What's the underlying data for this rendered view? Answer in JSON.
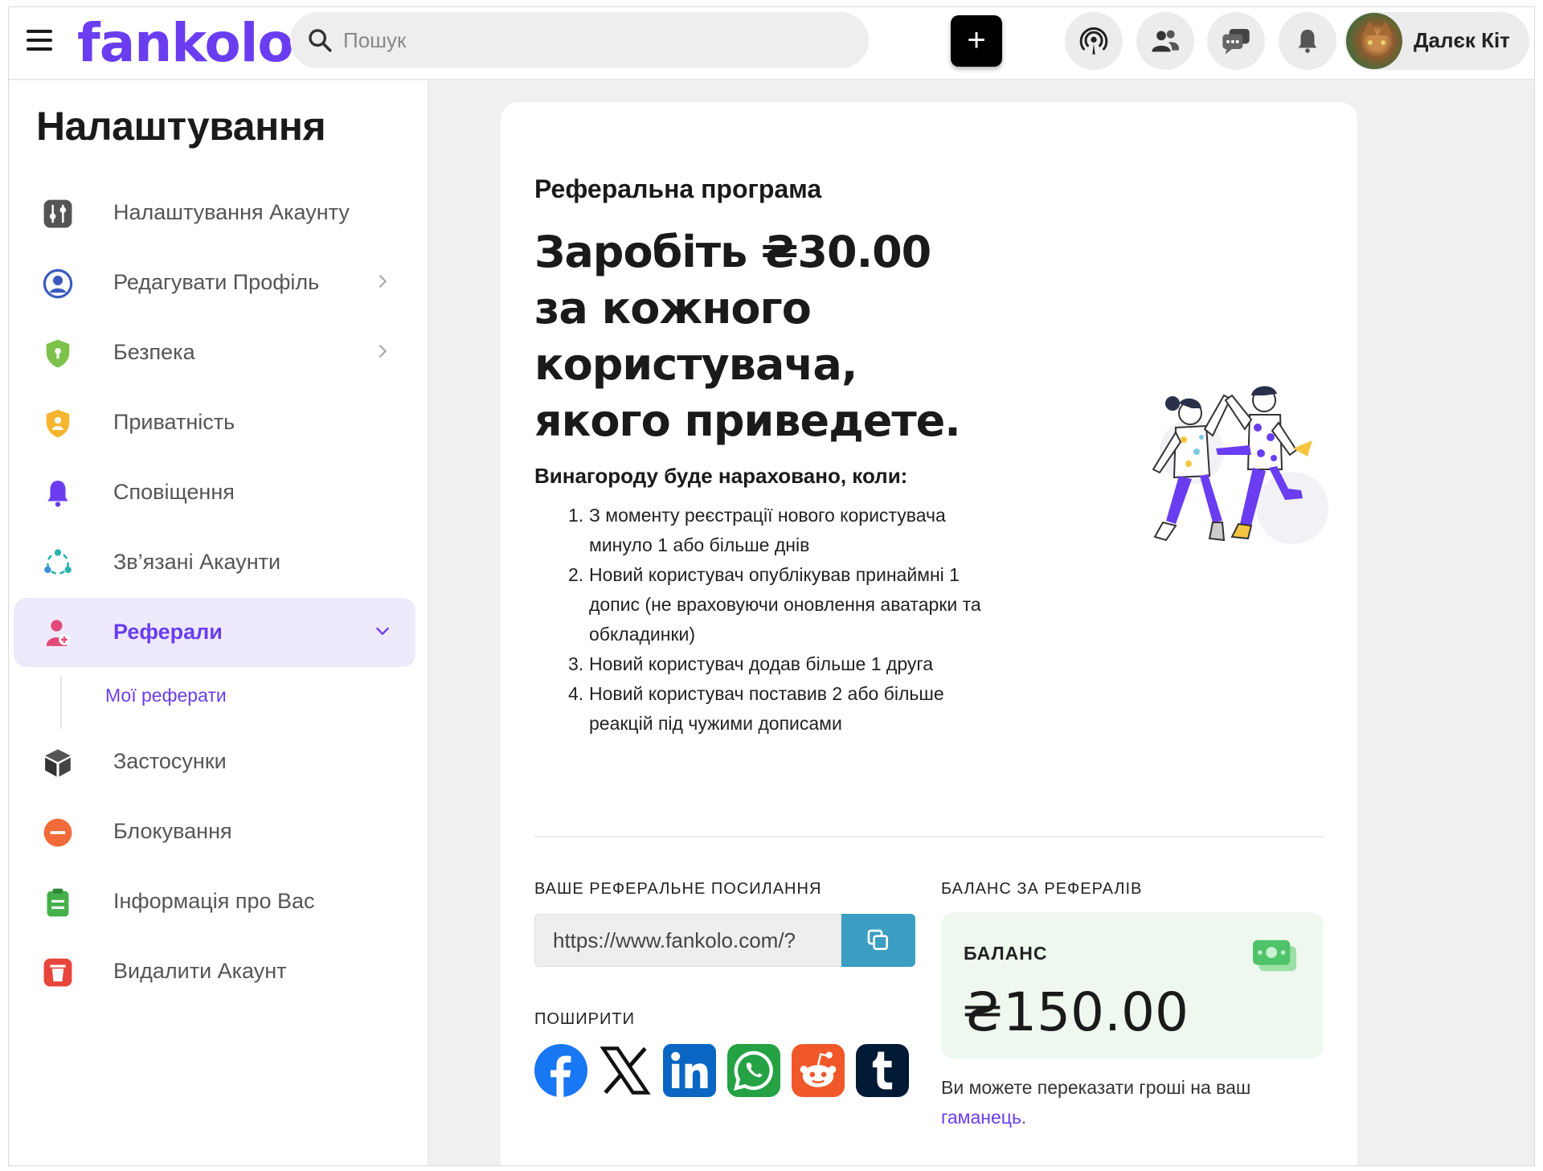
{
  "header": {
    "logo": "fankolo",
    "search_placeholder": "Пошук",
    "user_name": "Далєк Кіт"
  },
  "sidebar": {
    "title": "Налаштування",
    "items": [
      {
        "label": "Налаштування Акаунту",
        "icon": "sliders-icon"
      },
      {
        "label": "Редагувати Профіль",
        "icon": "user-circle-icon"
      },
      {
        "label": "Безпека",
        "icon": "shield-icon"
      },
      {
        "label": "Приватність",
        "icon": "privacy-shield-icon"
      },
      {
        "label": "Сповіщення",
        "icon": "bell-icon"
      },
      {
        "label": "Зв’язані Акаунти",
        "icon": "connected-accounts-icon"
      },
      {
        "label": "Реферали",
        "icon": "referral-icon"
      },
      {
        "label": "Застосунки",
        "icon": "cube-icon"
      },
      {
        "label": "Блокування",
        "icon": "block-icon"
      },
      {
        "label": "Інформація про Вас",
        "icon": "clipboard-icon"
      },
      {
        "label": "Видалити Акаунт",
        "icon": "trash-icon"
      }
    ],
    "sub_item": "Мої реферати",
    "active_color": "#6a3df0"
  },
  "main": {
    "heading": "Реферальна програма",
    "headline": "Заробіть ₴30.00 за кожного користувача, якого приведете.",
    "reward_heading": "Винагороду буде нараховано, коли:",
    "reward_conditions": [
      "З моменту реєстрації нового користувача минуло 1 або більше днів",
      "Новий користувач опублікував принаймні 1 допис (не враховуючи оновлення аватарки та обкладинки)",
      "Новий користувач додав більше 1 друга",
      "Новий користувач поставив 2 або більше реакцій під чужими дописами"
    ],
    "referral_link_label": "ВАШЕ РЕФЕРАЛЬНЕ ПОСИЛАННЯ",
    "referral_link_value": "https://www.fankolo.com/?",
    "share_label": "ПОШИРИТИ",
    "share_targets": [
      "facebook",
      "x",
      "linkedin",
      "whatsapp",
      "reddit",
      "tumblr"
    ],
    "balance_section_label": "БАЛАНС ЗА РЕФЕРАЛІВ",
    "balance_label": "БАЛАНС",
    "balance_amount": "₴150.00",
    "balance_note": "Ви можете переказати гроші на ваш",
    "wallet_link": "гаманець."
  }
}
